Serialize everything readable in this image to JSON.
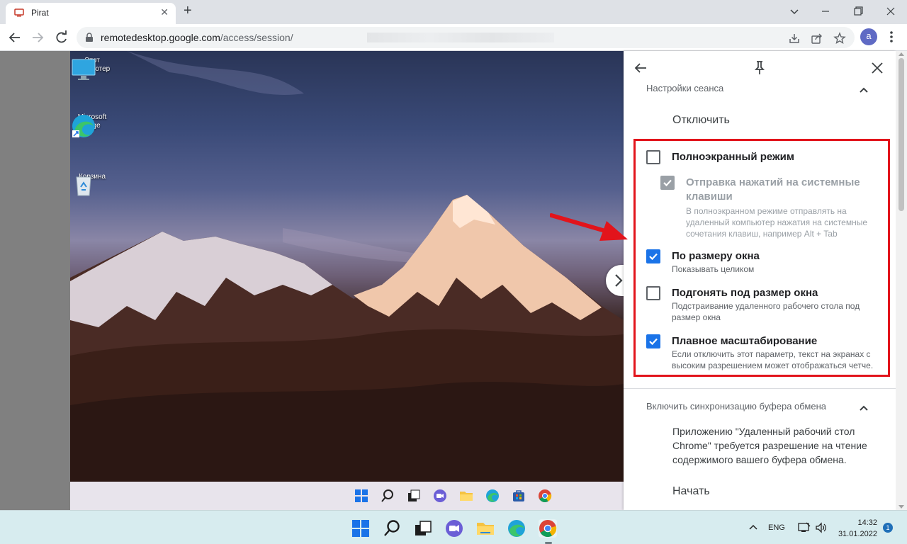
{
  "browser": {
    "tab_title": "Pirat",
    "url_host": "remotedesktop.google.com",
    "url_path": "/access/session/",
    "avatar_letter": "a"
  },
  "desktop": {
    "icons": [
      {
        "label": "Этот компьютер"
      },
      {
        "label": "Microsoft Edge"
      },
      {
        "label": "Корзина"
      }
    ]
  },
  "panel": {
    "section_session": "Настройки сеанса",
    "disconnect": "Отключить",
    "options": [
      {
        "label": "Полноэкранный режим",
        "desc": "",
        "checked": false
      },
      {
        "label": "Отправка нажатий на системные клавиши",
        "desc": "В полноэкранном режиме отправлять на удаленный компьютер нажатия на системные сочетания клавиш, например Alt + Tab",
        "checked": true,
        "disabled": true
      },
      {
        "label": "По размеру окна",
        "desc": "Показывать целиком",
        "checked": true
      },
      {
        "label": "Подгонять под размер окна",
        "desc": "Подстраивание удаленного рабочего стола под размер окна",
        "checked": false
      },
      {
        "label": "Плавное масштабирование",
        "desc": "Если отключить этот параметр, текст на экранах с высоким разрешением может отображаться четче.",
        "checked": true
      }
    ],
    "section_clipboard": "Включить синхронизацию буфера обмена",
    "clipboard_text": "Приложению \"Удаленный рабочий стол Chrome\" требуется разрешение на чтение содержимого вашего буфера обмена.",
    "start": "Начать"
  },
  "tray": {
    "lang": "ENG",
    "time": "14:32",
    "date": "31.01.2022",
    "notifications": "1"
  },
  "colors": {
    "accent": "#1a73e8",
    "highlight": "#e2141b"
  }
}
